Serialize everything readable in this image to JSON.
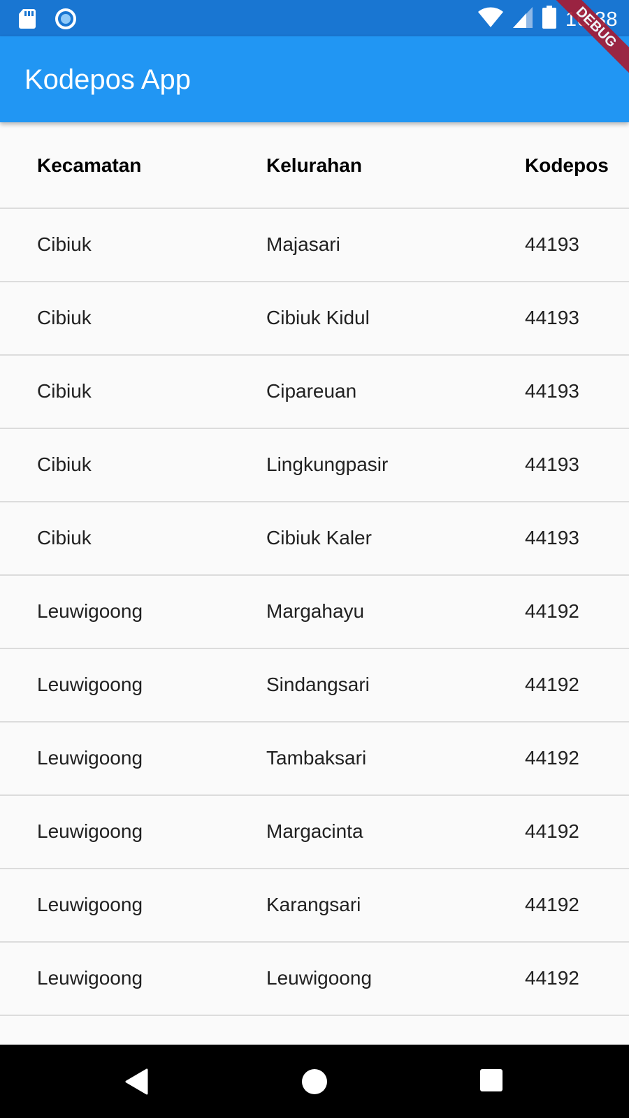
{
  "status_bar": {
    "time": "10:38",
    "icons": [
      "sd-card-icon",
      "sync-icon",
      "wifi-icon",
      "signal-icon",
      "battery-icon"
    ]
  },
  "app_bar": {
    "title": "Kodepos App",
    "debug_label": "DEBUG"
  },
  "table": {
    "headers": [
      "Kecamatan",
      "Kelurahan",
      "Kodepos"
    ],
    "rows": [
      [
        "Cibiuk",
        "Majasari",
        "44193"
      ],
      [
        "Cibiuk",
        "Cibiuk Kidul",
        "44193"
      ],
      [
        "Cibiuk",
        "Cipareuan",
        "44193"
      ],
      [
        "Cibiuk",
        "Lingkungpasir",
        "44193"
      ],
      [
        "Cibiuk",
        "Cibiuk Kaler",
        "44193"
      ],
      [
        "Leuwigoong",
        "Margahayu",
        "44192"
      ],
      [
        "Leuwigoong",
        "Sindangsari",
        "44192"
      ],
      [
        "Leuwigoong",
        "Tambaksari",
        "44192"
      ],
      [
        "Leuwigoong",
        "Margacinta",
        "44192"
      ],
      [
        "Leuwigoong",
        "Karangsari",
        "44192"
      ],
      [
        "Leuwigoong",
        "Leuwigoong",
        "44192"
      ]
    ]
  },
  "nav_bar": {
    "buttons": [
      "back-icon",
      "home-icon",
      "recents-icon"
    ]
  },
  "colors": {
    "status_bar": "#1976d2",
    "app_bar": "#2196f3",
    "debug_banner": "#a51d35",
    "background": "#fafafa",
    "divider": "#dcdcdc"
  }
}
